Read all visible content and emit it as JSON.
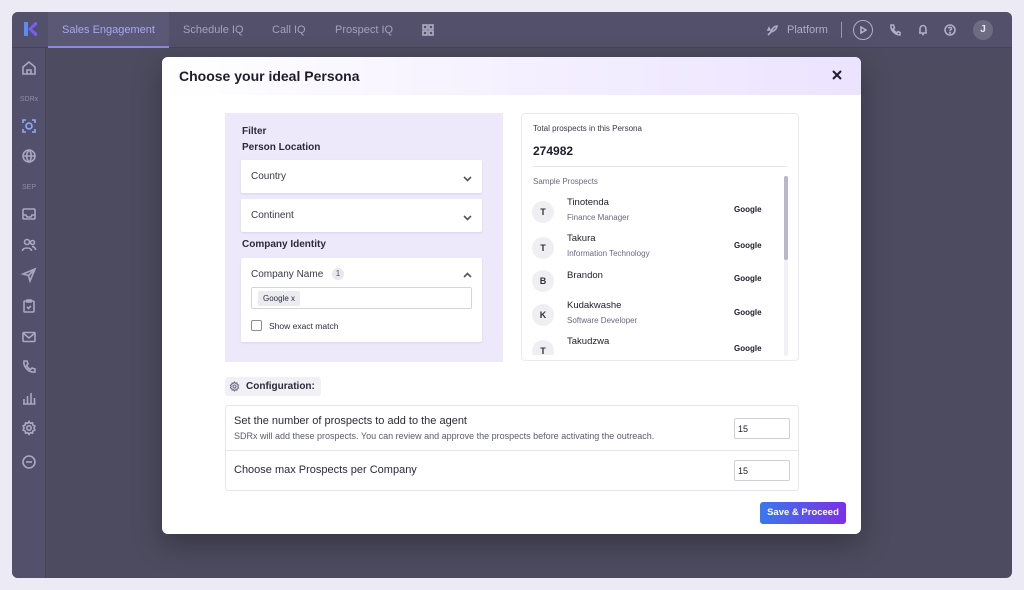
{
  "topbar": {
    "tabs": [
      {
        "label": "Sales Engagement",
        "active": true
      },
      {
        "label": "Schedule IQ",
        "active": false
      },
      {
        "label": "Call IQ",
        "active": false
      },
      {
        "label": "Prospect IQ",
        "active": false
      }
    ],
    "platform_label": "Platform",
    "user_initial": "J",
    "icons": [
      "logo-icon",
      "grid-icon",
      "rocket-icon",
      "play-icon",
      "phone-icon",
      "bell-icon",
      "help-icon"
    ]
  },
  "sidebar": {
    "section_sdrx": "SDRx",
    "section_sep": "SEP",
    "icons": [
      "home-icon",
      "sdrx-agent-icon",
      "globe-icon",
      "inbox-icon",
      "contacts-icon",
      "send-icon",
      "tasks-icon",
      "mail-icon",
      "phone-icon",
      "reports-icon",
      "settings-icon",
      "more-icon"
    ]
  },
  "modal": {
    "title": "Choose your ideal Persona",
    "filter": {
      "heading": "Filter",
      "person_location": "Person Location",
      "country": "Country",
      "continent": "Continent",
      "company_identity": "Company Identity",
      "company_name": "Company Name",
      "company_name_count": "1",
      "tag": "Google x",
      "exact_match_label": "Show exact match",
      "exact_match_checked": false
    },
    "prospects": {
      "total_label": "Total prospects in this Persona",
      "total_value": "274982",
      "sample_label": "Sample Prospects",
      "items": [
        {
          "initial": "T",
          "name": "Tinotenda",
          "role": "Finance Manager",
          "company": "Google"
        },
        {
          "initial": "T",
          "name": "Takura",
          "role": "Information Technology",
          "company": "Google"
        },
        {
          "initial": "B",
          "name": "Brandon",
          "role": "",
          "company": "Google"
        },
        {
          "initial": "K",
          "name": "Kudakwashe",
          "role": "Software Developer",
          "company": "Google"
        },
        {
          "initial": "T",
          "name": "Takudzwa",
          "role": "",
          "company": "Google"
        }
      ]
    },
    "configuration": {
      "heading": "Configuration:",
      "rows": [
        {
          "title": "Set the number of prospects to add to the agent",
          "subtitle": "SDRx will add these prospects. You can review and approve the prospects before activating the outreach.",
          "value": "15"
        },
        {
          "title": "Choose max Prospects per Company",
          "subtitle": "",
          "value": "15"
        }
      ]
    },
    "save_label": "Save & Proceed"
  },
  "colors": {
    "accent_start": "#3a78ee",
    "accent_end": "#7c2fe6",
    "filter_panel_bg": "#ede9fb",
    "overlay": "#4d4b5f"
  }
}
